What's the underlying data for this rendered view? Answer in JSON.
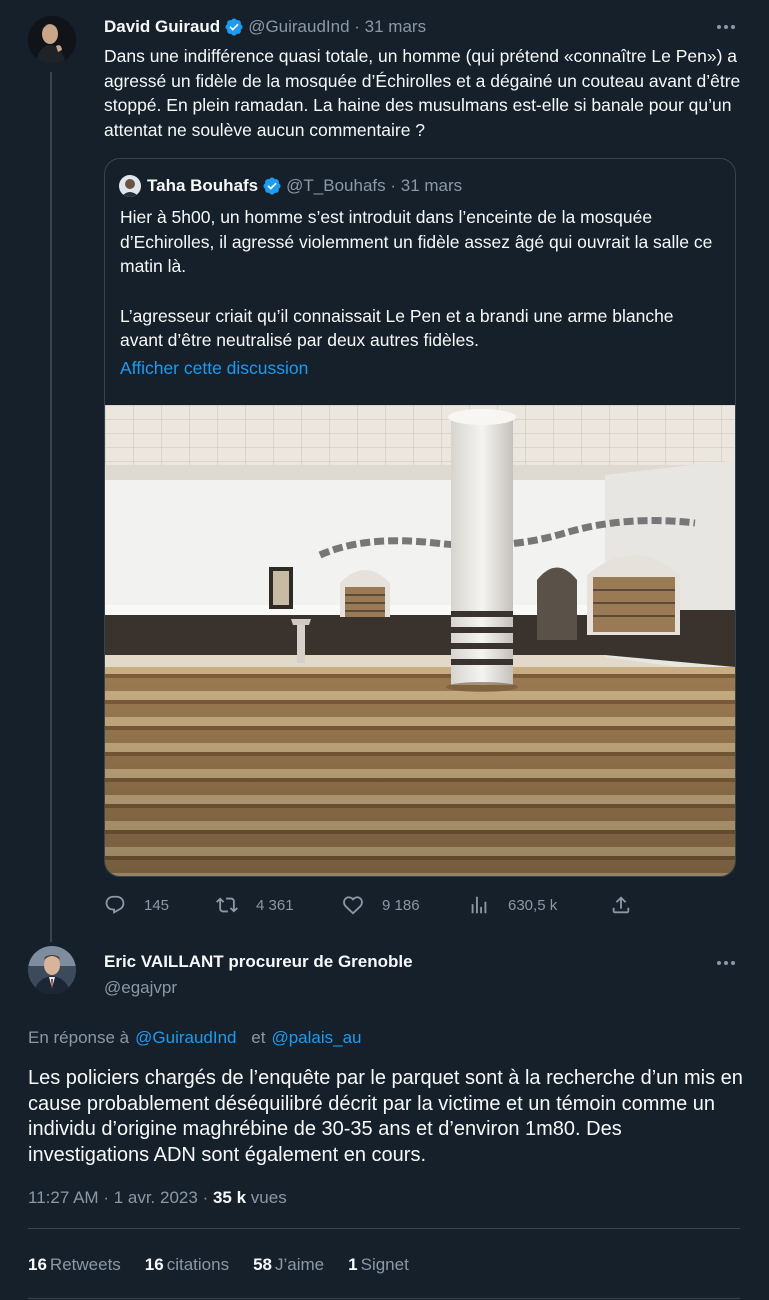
{
  "parent_tweet": {
    "author_name": "David Guiraud",
    "handle": "@GuiraudInd",
    "date": "31 mars",
    "text": "Dans une indifférence quasi totale, un homme (qui prétend «connaître Le Pen») a agressé un fidèle de la mosquée d’Échirolles et a dégainé un couteau avant d’être stoppé. En plein ramadan. La haine des musulmans est-elle si banale pour qu’un attentat ne soulève aucun commentaire ?",
    "quoted": {
      "author_name": "Taha Bouhafs",
      "handle": "@T_Bouhafs",
      "date": "31 mars",
      "paragraph1": "Hier à 5h00, un homme s’est introduit dans l’enceinte de la mosquée d’Echirolles, il agressé violemment un fidèle assez âgé qui ouvrait la salle ce matin là.",
      "paragraph2": "L’agresseur criait qu’il connaissait Le Pen et a brandi une arme blanche avant d’être neutralisé par deux autres fidèles.",
      "show_thread": "Afficher cette discussion"
    },
    "actions": {
      "replies": "145",
      "retweets": "4 361",
      "likes": "9 186",
      "views": "630,5 k"
    }
  },
  "main_tweet": {
    "author_name": "Eric VAILLANT procureur de Grenoble",
    "handle": "@egajvpr",
    "reply_prefix": "En réponse à",
    "reply_to_1": "@GuiraudInd",
    "reply_and": "et",
    "reply_to_2": "@palais_au",
    "text": "Les policiers chargés de l’enquête par le parquet sont à la recherche d’un mis en cause probablement déséquilibré décrit par la victime et un témoin comme un individu d’origine maghrébine de 30-35 ans et d’environ 1m80. Des investigations ADN sont également en cours.",
    "time": "11:27 AM",
    "date": "1 avr. 2023",
    "views_count": "35 k",
    "views_label": "vues",
    "stats": {
      "retweets_count": "16",
      "retweets_label": "Retweets",
      "quotes_count": "16",
      "quotes_label": "citations",
      "likes_count": "58",
      "likes_label": "J’aime",
      "bookmarks_count": "1",
      "bookmarks_label": "Signet"
    }
  },
  "colors": {
    "background": "#15202b",
    "accent": "#1d9bf0",
    "muted_text": "#8b98a5",
    "border": "#38444d"
  },
  "icons": [
    "verified-badge-icon",
    "more-icon",
    "reply-icon",
    "retweet-icon",
    "like-icon",
    "views-icon",
    "share-icon"
  ]
}
